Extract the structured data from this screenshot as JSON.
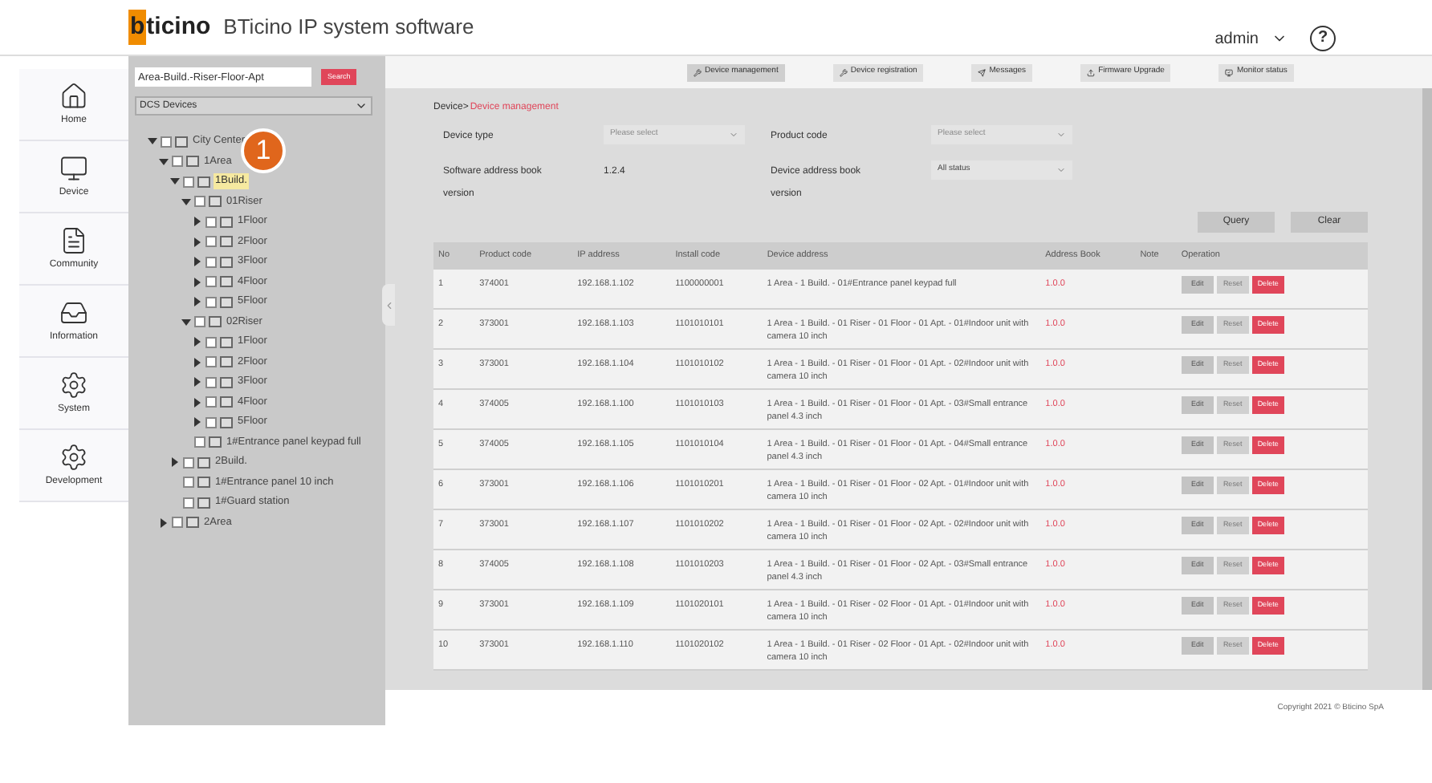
{
  "header": {
    "logo": {
      "mark": "b",
      "rest": "ticino"
    },
    "title": "BTicino IP system software",
    "user": "admin",
    "help": "?"
  },
  "nav": [
    {
      "label": "Home"
    },
    {
      "label": "Device"
    },
    {
      "label": "Community"
    },
    {
      "label": "Information"
    },
    {
      "label": "System"
    },
    {
      "label": "Development"
    }
  ],
  "sidebar": {
    "search": {
      "placeholder": "Area-Build.-Riser-Floor-Apt"
    },
    "search_button": "Search",
    "filter": "DCS Devices",
    "tree": [
      {
        "label": "City Center",
        "expanded": true,
        "checked": false,
        "selected": false,
        "children": [
          {
            "label": "1Area",
            "expanded": true,
            "checked": false,
            "selected": false,
            "children": [
              {
                "label": "1Build.",
                "expanded": true,
                "checked": false,
                "selected": true,
                "children": [
                  {
                    "label": "01Riser",
                    "expanded": true,
                    "checked": false,
                    "selected": false,
                    "children": [
                      {
                        "label": "1Floor",
                        "expanded": false,
                        "checked": false,
                        "selected": false
                      },
                      {
                        "label": "2Floor",
                        "expanded": false,
                        "checked": false,
                        "selected": false
                      },
                      {
                        "label": "3Floor",
                        "expanded": false,
                        "checked": false,
                        "selected": false
                      },
                      {
                        "label": "4Floor",
                        "expanded": false,
                        "checked": false,
                        "selected": false
                      },
                      {
                        "label": "5Floor",
                        "expanded": false,
                        "checked": false,
                        "selected": false
                      }
                    ]
                  },
                  {
                    "label": "02Riser",
                    "expanded": true,
                    "checked": false,
                    "selected": false,
                    "children": [
                      {
                        "label": "1Floor",
                        "expanded": false,
                        "checked": false,
                        "selected": false
                      },
                      {
                        "label": "2Floor",
                        "expanded": false,
                        "checked": false,
                        "selected": false
                      },
                      {
                        "label": "3Floor",
                        "expanded": false,
                        "checked": false,
                        "selected": false
                      },
                      {
                        "label": "4Floor",
                        "expanded": false,
                        "checked": false,
                        "selected": false
                      },
                      {
                        "label": "5Floor",
                        "expanded": false,
                        "checked": false,
                        "selected": false
                      }
                    ]
                  },
                  {
                    "label": "1#Entrance panel keypad full",
                    "checked": false,
                    "selected": false
                  }
                ]
              },
              {
                "label": "2Build.",
                "expanded": false,
                "checked": false,
                "selected": false
              },
              {
                "label": "1#Entrance panel 10 inch",
                "checked": false,
                "selected": false
              },
              {
                "label": "1#Guard station",
                "checked": false,
                "selected": false
              }
            ]
          },
          {
            "label": "2Area",
            "expanded": false,
            "checked": false,
            "selected": false
          }
        ]
      }
    ]
  },
  "callout": "1",
  "toolbar": [
    {
      "label": "Device management",
      "selected": true
    },
    {
      "label": "Device registration",
      "selected": false
    },
    {
      "label": "Messages",
      "selected": false
    },
    {
      "label": "Firmware Upgrade",
      "selected": false
    },
    {
      "label": "Monitor status",
      "selected": false
    }
  ],
  "breadcrumb": {
    "parent": "Device>",
    "current": "Device management"
  },
  "filters": [
    {
      "label": "Device type",
      "kind": "select",
      "placeholder": "Please select"
    },
    {
      "label": "Product code",
      "kind": "select",
      "placeholder": "Please select"
    },
    {
      "label": "Software address book version",
      "kind": "text",
      "value": "1.2.4"
    },
    {
      "label": "Device address book version",
      "kind": "select",
      "value": "All status"
    }
  ],
  "actions": [
    "Query",
    "Clear"
  ],
  "table": {
    "columns": [
      "No",
      "Product code",
      "IP address",
      "Install code",
      "Device address",
      "Address Book",
      "Note",
      "Operation"
    ],
    "rows": [
      {
        "no": "1",
        "product": "374001",
        "ip": "192.168.1.102",
        "install": "1100000001",
        "address": "1 Area - 1 Build. - 01#Entrance panel keypad full",
        "book": "1.0.0",
        "actions": [
          "Edit",
          "Reset",
          "Delete"
        ]
      },
      {
        "no": "2",
        "product": "373001",
        "ip": "192.168.1.103",
        "install": "1101010101",
        "address": "1 Area - 1 Build. - 01 Riser - 01 Floor - 01 Apt. - 01#Indoor unit with camera 10 inch",
        "book": "1.0.0",
        "actions": [
          "Edit",
          "Reset",
          "Delete"
        ]
      },
      {
        "no": "3",
        "product": "373001",
        "ip": "192.168.1.104",
        "install": "1101010102",
        "address": "1 Area - 1 Build. - 01 Riser - 01 Floor - 01 Apt. - 02#Indoor unit with camera 10 inch",
        "book": "1.0.0",
        "actions": [
          "Edit",
          "Reset",
          "Delete"
        ]
      },
      {
        "no": "4",
        "product": "374005",
        "ip": "192.168.1.100",
        "install": "1101010103",
        "address": "1 Area - 1 Build. - 01 Riser - 01 Floor - 01 Apt. - 03#Small entrance panel 4.3 inch",
        "book": "1.0.0",
        "actions": [
          "Edit",
          "Reset",
          "Delete"
        ]
      },
      {
        "no": "5",
        "product": "374005",
        "ip": "192.168.1.105",
        "install": "1101010104",
        "address": "1 Area - 1 Build. - 01 Riser - 01 Floor - 01 Apt. - 04#Small entrance panel 4.3 inch",
        "book": "1.0.0",
        "actions": [
          "Edit",
          "Reset",
          "Delete"
        ]
      },
      {
        "no": "6",
        "product": "373001",
        "ip": "192.168.1.106",
        "install": "1101010201",
        "address": "1 Area - 1 Build. - 01 Riser - 01 Floor - 02 Apt. - 01#Indoor unit with camera 10 inch",
        "book": "1.0.0",
        "actions": [
          "Edit",
          "Reset",
          "Delete"
        ]
      },
      {
        "no": "7",
        "product": "373001",
        "ip": "192.168.1.107",
        "install": "1101010202",
        "address": "1 Area - 1 Build. - 01 Riser - 01 Floor - 02 Apt. - 02#Indoor unit with camera 10 inch",
        "book": "1.0.0",
        "actions": [
          "Edit",
          "Reset",
          "Delete"
        ]
      },
      {
        "no": "8",
        "product": "374005",
        "ip": "192.168.1.108",
        "install": "1101010203",
        "address": "1 Area - 1 Build. - 01 Riser - 01 Floor - 02 Apt. - 03#Small entrance panel 4.3 inch",
        "book": "1.0.0",
        "actions": [
          "Edit",
          "Reset",
          "Delete"
        ]
      },
      {
        "no": "9",
        "product": "373001",
        "ip": "192.168.1.109",
        "install": "1101020101",
        "address": "1 Area - 1 Build. - 01 Riser - 02 Floor - 01 Apt. - 01#Indoor unit with camera 10 inch",
        "book": "1.0.0",
        "actions": [
          "Edit",
          "Reset",
          "Delete"
        ]
      },
      {
        "no": "10",
        "product": "373001",
        "ip": "192.168.1.110",
        "install": "1101020102",
        "address": "1 Area - 1 Build. - 01 Riser - 02 Floor - 01 Apt. - 02#Indoor unit with camera 10 inch",
        "book": "1.0.0",
        "actions": [
          "Edit",
          "Reset",
          "Delete"
        ]
      }
    ]
  },
  "footer": "Copyright 2021 © Bticino SpA"
}
